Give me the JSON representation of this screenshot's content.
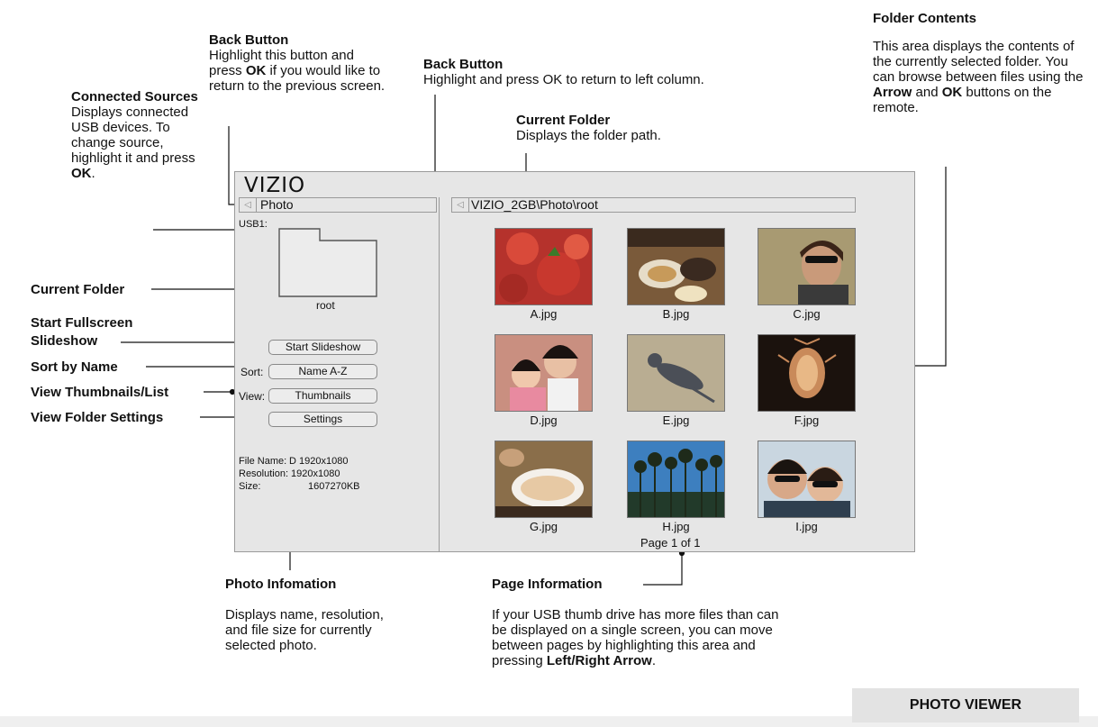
{
  "callouts": {
    "connected_sources": {
      "title": "Connected Sources",
      "text": "Displays connected USB devices. To change source, highlight it and press ",
      "key": "OK",
      "end": "."
    },
    "back_button_left": {
      "title": "Back Button",
      "text_a": "Highlight this button and press ",
      "key": "OK",
      "text_b": " if you would like to return to the previous screen."
    },
    "back_button_right": {
      "title": "Back Button",
      "text": "Highlight and press OK to return to left column."
    },
    "current_folder_top": {
      "title": "Current Folder",
      "text": "Displays the folder path."
    },
    "folder_contents": {
      "title": "Folder Contents",
      "text_a": "This area displays the contents of the currently selected folder. You can browse between files using the ",
      "key1": "Arrow",
      "text_b": " and ",
      "key2": "OK",
      "text_c": " buttons on the remote."
    },
    "current_folder_left": "Current Folder",
    "start_slideshow": "Start Fullscreen Slideshow",
    "sort_by_name": "Sort by Name",
    "view_thumbnails": "View Thumbnails/List",
    "view_folder_settings": "View Folder Settings",
    "photo_information": {
      "title": "Photo Infomation",
      "text": "Displays name, resolution, and file size for currently selected photo."
    },
    "page_information": {
      "title": "Page Information",
      "text_a": "If your USB thumb drive has more files than can be displayed on a single screen, you can move between pages by highlighting this area and pressing ",
      "key": "Left/Right Arrow",
      "end": "."
    }
  },
  "screen": {
    "logo": "VIZIO",
    "left_nav": "Photo",
    "right_nav": "VIZIO_2GB\\Photo\\root",
    "usb_label": "USB1:",
    "folder_name": "root",
    "start_slideshow_btn": "Start Slideshow",
    "sort_caption": "Sort:",
    "sort_value": "Name A-Z",
    "view_caption": "View:",
    "view_value": "Thumbnails",
    "settings_btn": "Settings",
    "info": {
      "file_name_label": "File Name:",
      "file_name_value": "D 1920x1080",
      "resolution_label": "Resolution:",
      "resolution_value": "1920x1080",
      "size_label": "Size:",
      "size_value": "1607270KB"
    },
    "thumbnails": [
      {
        "name": "A.jpg",
        "bg": "#b5322c"
      },
      {
        "name": "B.jpg",
        "bg": "#7a5a3a"
      },
      {
        "name": "C.jpg",
        "bg": "#a89a72"
      },
      {
        "name": "D.jpg",
        "bg": "#c98f80"
      },
      {
        "name": "E.jpg",
        "bg": "#b9ad92"
      },
      {
        "name": "F.jpg",
        "bg": "#1b120d"
      },
      {
        "name": "G.jpg",
        "bg": "#8a6e4a"
      },
      {
        "name": "H.jpg",
        "bg": "#3d7fbf"
      },
      {
        "name": "I.jpg",
        "bg": "#c9d6e0"
      }
    ],
    "page_info": "Page 1 of 1"
  },
  "footer": {
    "label": "PHOTO VIEWER"
  }
}
